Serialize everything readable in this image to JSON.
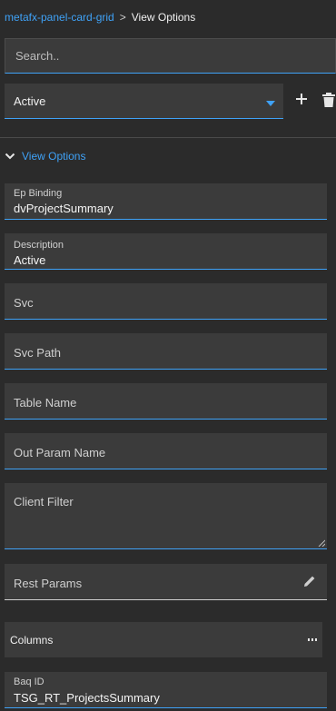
{
  "breadcrumb": {
    "parent": "metafx-panel-card-grid",
    "separator": ">",
    "current": "View Options"
  },
  "search": {
    "placeholder": "Search.."
  },
  "view_select": {
    "value": "Active"
  },
  "toolbar": {
    "add_icon": "plus-icon",
    "delete_icon": "trash-icon"
  },
  "section": {
    "label": "View Options",
    "expanded": true
  },
  "fields": {
    "ep_binding": {
      "label": "Ep Binding",
      "value": "dvProjectSummary"
    },
    "description": {
      "label": "Description",
      "value": "Active"
    },
    "svc": {
      "placeholder": "Svc"
    },
    "svc_path": {
      "placeholder": "Svc Path"
    },
    "table_name": {
      "placeholder": "Table Name"
    },
    "out_param_name": {
      "placeholder": "Out Param Name"
    },
    "client_filter": {
      "placeholder": "Client Filter"
    },
    "rest_params": {
      "placeholder": "Rest Params"
    },
    "baq_id": {
      "label": "Baq ID",
      "value": "TSG_RT_ProjectsSummary"
    }
  },
  "columns": {
    "label": "Columns",
    "menu_icon": "ellipsis-icon"
  },
  "colors": {
    "accent": "#3fa2f7",
    "background": "#2b2b2b",
    "field_bg": "#3b3b3b"
  }
}
